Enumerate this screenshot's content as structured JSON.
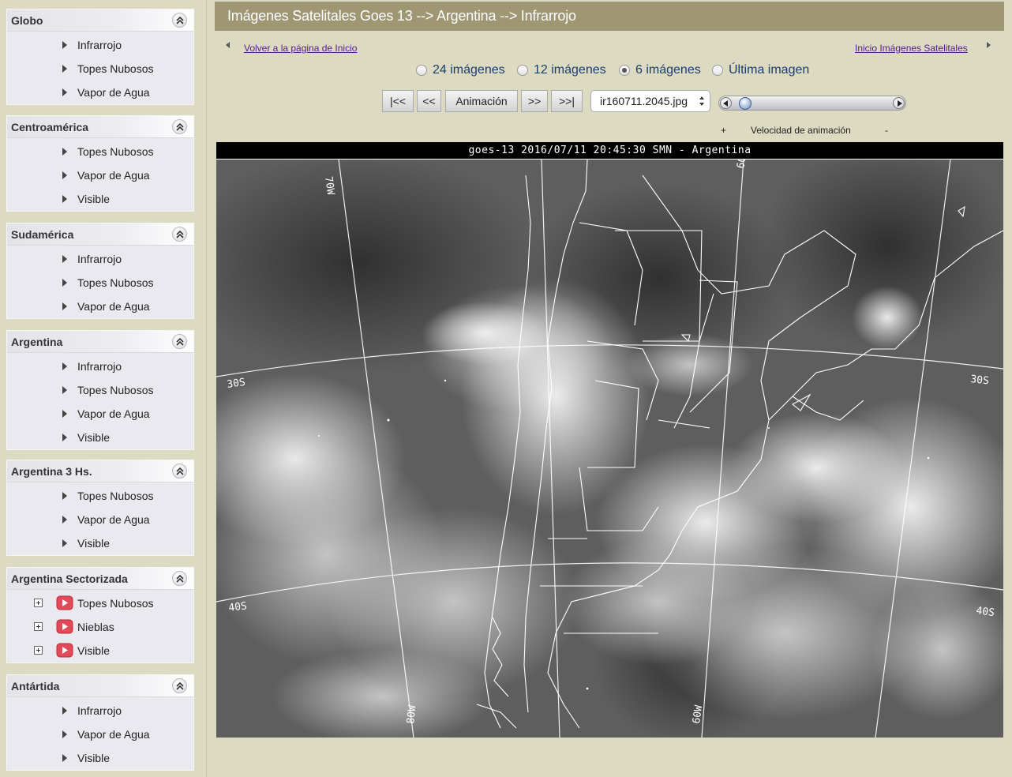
{
  "sidebar": {
    "panels": [
      {
        "title": "Globo",
        "items": [
          {
            "label": "Infrarrojo"
          },
          {
            "label": "Topes Nubosos"
          },
          {
            "label": "Vapor de Agua"
          }
        ]
      },
      {
        "title": "Centroamérica",
        "items": [
          {
            "label": "Topes Nubosos"
          },
          {
            "label": "Vapor de Agua"
          },
          {
            "label": "Visible"
          }
        ]
      },
      {
        "title": "Sudamérica",
        "items": [
          {
            "label": "Infrarrojo"
          },
          {
            "label": "Topes Nubosos"
          },
          {
            "label": "Vapor de Agua"
          }
        ]
      },
      {
        "title": "Argentina",
        "items": [
          {
            "label": "Infrarrojo"
          },
          {
            "label": "Topes Nubosos"
          },
          {
            "label": "Vapor de Agua"
          },
          {
            "label": "Visible"
          }
        ]
      },
      {
        "title": "Argentina 3 Hs.",
        "items": [
          {
            "label": "Topes Nubosos"
          },
          {
            "label": "Vapor de Agua"
          },
          {
            "label": "Visible"
          }
        ]
      },
      {
        "title": "Argentina Sectorizada",
        "items": [
          {
            "label": "Topes Nubosos"
          },
          {
            "label": "Nieblas"
          },
          {
            "label": "Visible"
          }
        ]
      },
      {
        "title": "Antártida",
        "items": [
          {
            "label": "Infrarrojo"
          },
          {
            "label": "Vapor de Agua"
          },
          {
            "label": "Visible"
          }
        ]
      }
    ]
  },
  "header": {
    "title": "Imágenes Satelitales Goes 13 --> Argentina --> Infrarrojo"
  },
  "links": {
    "back_home": "Volver a la página de Inicio",
    "satellite_home": "Inicio Imágenes Satelitales"
  },
  "image_count_options": [
    {
      "label": "24 imágenes",
      "checked": false
    },
    {
      "label": "12 imágenes",
      "checked": false
    },
    {
      "label": "6 imágenes",
      "checked": true
    },
    {
      "label": "Última imagen",
      "checked": false
    }
  ],
  "player": {
    "first_label": "|<<",
    "prev_label": "<<",
    "animate_label": "Animación",
    "next_label": ">>",
    "last_label": ">>|",
    "selected_file": "ir160711.2045.jpg",
    "slider_position": 0.04
  },
  "speed": {
    "plus": "+",
    "label": "Velocidad de animación",
    "minus": "-"
  },
  "image": {
    "header": "goes-13 2016/07/11 20:45:30 SMN - Argentina",
    "grid_labels": [
      "70W",
      "60W",
      "80W",
      "60W",
      "30S",
      "30S",
      "40S",
      "40S",
      "60W",
      "80W"
    ]
  },
  "colors": {
    "title_bar": "#9f9674",
    "page_bg": "#dcdac0",
    "link": "#551a8b",
    "radio_text": "#1a3d6d"
  }
}
